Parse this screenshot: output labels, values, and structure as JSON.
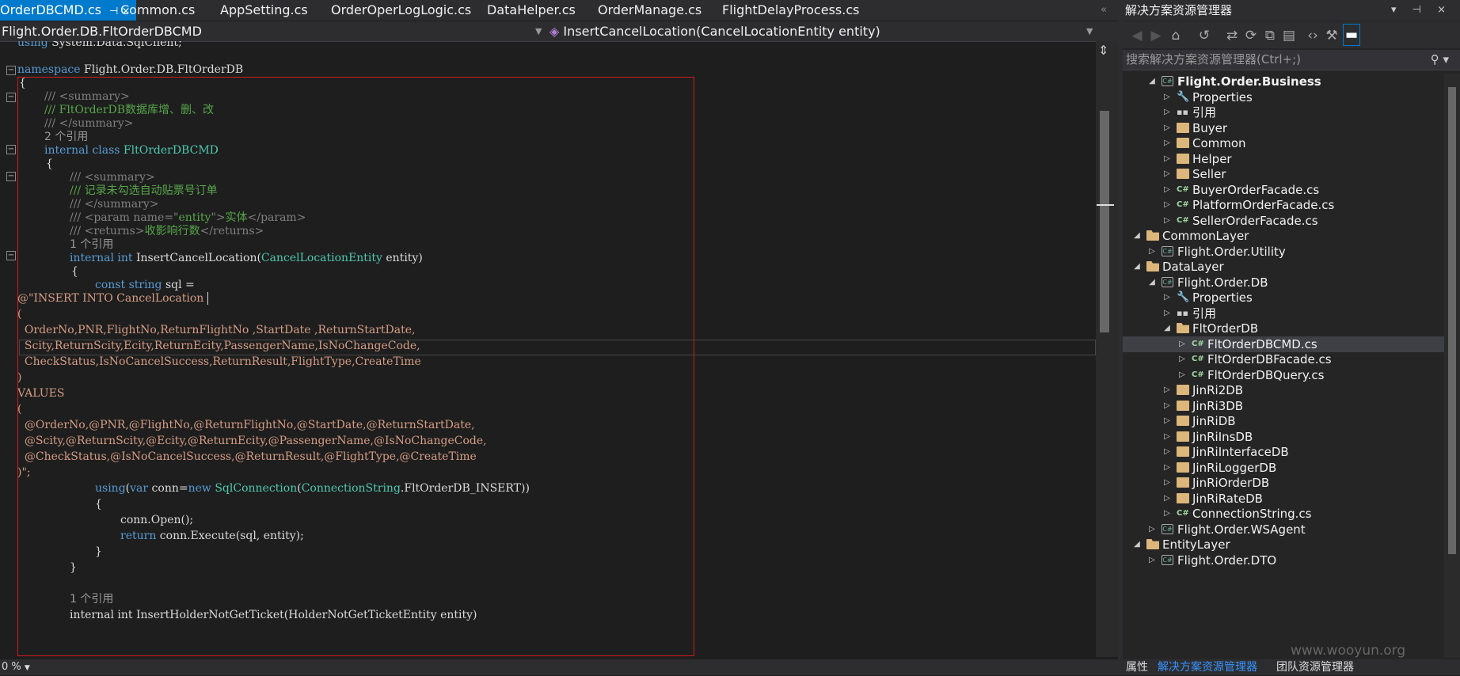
{
  "editor": {
    "tabs": [
      {
        "label": "OrderDBCMD.cs",
        "pin": "⊣ ×",
        "active": true
      },
      {
        "label": "Common.cs"
      },
      {
        "label": "AppSetting.cs"
      },
      {
        "label": "OrderOperLogLogic.cs"
      },
      {
        "label": "DataHelper.cs"
      },
      {
        "label": "OrderManage.cs"
      },
      {
        "label": "FlightDelayProcess.cs"
      }
    ],
    "overflow_icon": "«",
    "nav_class": "Flight.Order.DB.FltOrderDBCMD",
    "nav_member": "InsertCancelLocation(CancelLocationEntity entity)",
    "nav_member_icon": "method-icon",
    "code": {
      "using_kw": "using",
      "using_ns": " System.Data.SqlClient;",
      "namespace_kw": "namespace",
      "namespace_name": " Flight.Order.DB.FltOrderDB",
      "open_brace": "{",
      "close_brace": "}",
      "summary_open": "/// <summary>",
      "summary_class_desc": "/// FltOrderDB数据库增、删、改",
      "summary_close": "/// </summary>",
      "refs_2": "2 个引用",
      "internal_kw": "internal",
      "class_kw": "class",
      "class_name": " FltOrderDBCMD",
      "summary_method_desc": "/// 记录未勾选自动贴票号订单",
      "param_doc_pre": "/// <param name=\"",
      "param_doc_name": "entity",
      "param_doc_mid": "\">",
      "param_doc_desc": "实体",
      "param_doc_post": "</param>",
      "returns_doc_pre": "/// <returns>",
      "returns_doc_desc": "收影响行数",
      "returns_doc_post": "</returns>",
      "refs_1": "1 个引用",
      "int_kw": "int",
      "method_name": " InsertCancelLocation(",
      "param_type": "CancelLocationEntity",
      "param_name": " entity)",
      "const_kw": "const",
      "string_kw": "string",
      "sql_decl": " sql =",
      "sql_1": "@\"INSERT INTO CancelLocation ",
      "sql_2": "(",
      "sql_3": "  OrderNo,PNR,FlightNo,ReturnFlightNo ,StartDate ,ReturnStartDate,",
      "sql_4": "  Scity,ReturnScity,Ecity,ReturnEcity,PassengerName,IsNoChangeCode,",
      "sql_5": "  CheckStatus,IsNoCancelSuccess,ReturnResult,FlightType,CreateTime",
      "sql_6": ")",
      "sql_7": "VALUES",
      "sql_8": "(",
      "sql_9": "  @OrderNo,@PNR,@FlightNo,@ReturnFlightNo,@StartDate,@ReturnStartDate,",
      "sql_10": "  @Scity,@ReturnScity,@Ecity,@ReturnEcity,@PassengerName,@IsNoChangeCode,",
      "sql_11": "  @CheckStatus,@IsNoCancelSuccess,@ReturnResult,@FlightType,@CreateTime",
      "sql_12": ")\";",
      "var_kw": "var",
      "conn_decl": " conn=",
      "new_kw": "new",
      "sqlconn_type": " SqlConnection",
      "paren_open": "(",
      "connstr_type": "ConnectionString",
      "connstr_member": ".FltOrderDB_INSERT))",
      "conn_open": "conn.Open();",
      "return_kw": "return",
      "execute_call": " conn.Execute(sql, entity);",
      "next_line_partial": "internal int InsertHolderNotGetTicket(HolderNotGetTicketEntity entity)"
    },
    "zoom": "0 %"
  },
  "solution_explorer": {
    "title": "解决方案资源管理器",
    "title_buttons": "▾ ⊣ ×",
    "search_placeholder": "搜索解决方案资源管理器(Ctrl+;)",
    "search_icon": "search-icon",
    "tree": [
      {
        "label": "Flight.Order.Business",
        "depth": 1,
        "icon": "csproj",
        "expanded": true,
        "bold": true
      },
      {
        "label": "Properties",
        "depth": 2,
        "icon": "wrench",
        "expanded": false
      },
      {
        "label": "引用",
        "depth": 2,
        "icon": "references",
        "expanded": false
      },
      {
        "label": "Buyer",
        "depth": 2,
        "icon": "folder",
        "expanded": false
      },
      {
        "label": "Common",
        "depth": 2,
        "icon": "folder",
        "expanded": false
      },
      {
        "label": "Helper",
        "depth": 2,
        "icon": "folder",
        "expanded": false
      },
      {
        "label": "Seller",
        "depth": 2,
        "icon": "folder",
        "expanded": false
      },
      {
        "label": "BuyerOrderFacade.cs",
        "depth": 2,
        "icon": "cs",
        "expanded": false
      },
      {
        "label": "PlatformOrderFacade.cs",
        "depth": 2,
        "icon": "cs",
        "expanded": false
      },
      {
        "label": "SellerOrderFacade.cs",
        "depth": 2,
        "icon": "cs",
        "expanded": false
      },
      {
        "label": "CommonLayer",
        "depth": 0,
        "icon": "open-folder",
        "expanded": true
      },
      {
        "label": "Flight.Order.Utility",
        "depth": 1,
        "icon": "csproj",
        "expanded": false
      },
      {
        "label": "DataLayer",
        "depth": 0,
        "icon": "open-folder",
        "expanded": true
      },
      {
        "label": "Flight.Order.DB",
        "depth": 1,
        "icon": "csproj",
        "expanded": true
      },
      {
        "label": "Properties",
        "depth": 2,
        "icon": "wrench",
        "expanded": false
      },
      {
        "label": "引用",
        "depth": 2,
        "icon": "references",
        "expanded": false
      },
      {
        "label": "FltOrderDB",
        "depth": 2,
        "icon": "open-folder",
        "expanded": true
      },
      {
        "label": "FltOrderDBCMD.cs",
        "depth": 3,
        "icon": "cs",
        "expanded": false,
        "selected": true
      },
      {
        "label": "FltOrderDBFacade.cs",
        "depth": 3,
        "icon": "cs",
        "expanded": false
      },
      {
        "label": "FltOrderDBQuery.cs",
        "depth": 3,
        "icon": "cs",
        "expanded": false
      },
      {
        "label": "JinRi2DB",
        "depth": 2,
        "icon": "folder",
        "expanded": false
      },
      {
        "label": "JinRi3DB",
        "depth": 2,
        "icon": "folder",
        "expanded": false
      },
      {
        "label": "JinRiDB",
        "depth": 2,
        "icon": "folder",
        "expanded": false
      },
      {
        "label": "JinRiInsDB",
        "depth": 2,
        "icon": "folder",
        "expanded": false
      },
      {
        "label": "JinRiInterfaceDB",
        "depth": 2,
        "icon": "folder",
        "expanded": false
      },
      {
        "label": "JinRiLoggerDB",
        "depth": 2,
        "icon": "folder",
        "expanded": false
      },
      {
        "label": "JinRiOrderDB",
        "depth": 2,
        "icon": "folder",
        "expanded": false
      },
      {
        "label": "JinRiRateDB",
        "depth": 2,
        "icon": "folder",
        "expanded": false
      },
      {
        "label": "ConnectionString.cs",
        "depth": 2,
        "icon": "cs",
        "expanded": false
      },
      {
        "label": "Flight.Order.WSAgent",
        "depth": 1,
        "icon": "csproj",
        "expanded": false
      },
      {
        "label": "EntityLayer",
        "depth": 0,
        "icon": "open-folder",
        "expanded": true
      },
      {
        "label": "Flight.Order.DTO",
        "depth": 1,
        "icon": "csproj",
        "expanded": false
      }
    ],
    "bottom_tabs": [
      {
        "label": "属性"
      },
      {
        "label": "解决方案资源管理器",
        "active": true
      },
      {
        "label": "团队资源管理器"
      }
    ]
  },
  "watermark": "www.wooyun.org",
  "colors": {
    "accent": "#007acc",
    "selection_box": "#d01c1c",
    "keyword": "#569cd6",
    "type": "#4ec9b0",
    "comment": "#57a64a"
  }
}
